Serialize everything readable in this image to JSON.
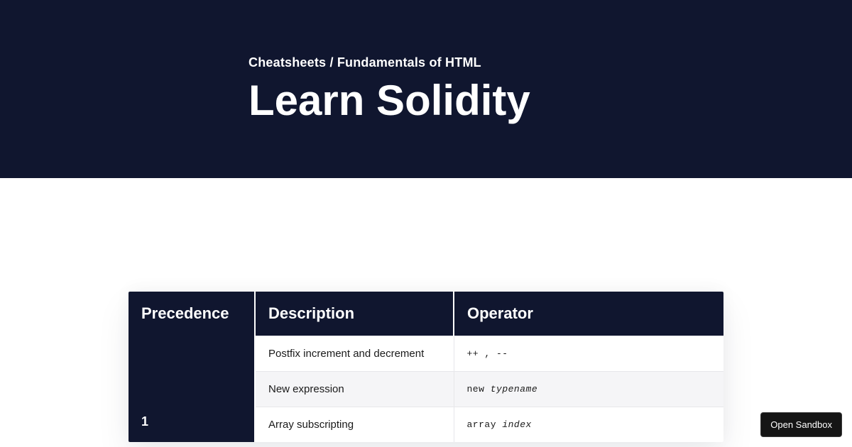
{
  "header": {
    "breadcrumb": "Cheatsheets / Fundamentals of HTML",
    "title": "Learn Solidity"
  },
  "table": {
    "headers": {
      "precedence": "Precedence",
      "description": "Description",
      "operator": "Operator"
    },
    "precedence_value": "1",
    "rows": [
      {
        "description": "Postfix increment and decrement",
        "operator_plain": "++ , --"
      },
      {
        "description": "New expression",
        "operator_kw": "new ",
        "operator_em": "typename"
      },
      {
        "description": "Array subscripting",
        "operator_kw": "array ",
        "operator_em": "index"
      }
    ]
  },
  "buttons": {
    "open_sandbox": "Open Sandbox"
  }
}
